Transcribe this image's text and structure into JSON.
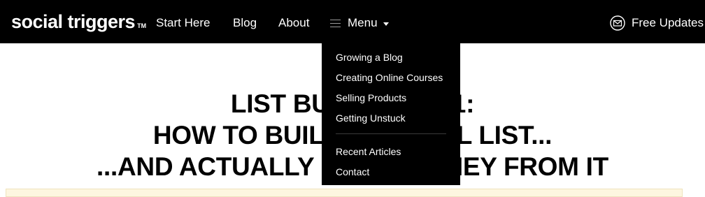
{
  "header": {
    "logo": "social triggers",
    "logo_tm": "TM",
    "nav": [
      {
        "label": "Start Here"
      },
      {
        "label": "Blog"
      },
      {
        "label": "About"
      }
    ],
    "menu_label": "Menu",
    "free_updates": "Free Updates"
  },
  "dropdown": {
    "items": [
      {
        "label": "Growing a Blog"
      },
      {
        "label": "Creating Online Courses"
      },
      {
        "label": "Selling Products"
      },
      {
        "label": "Getting Unstuck"
      }
    ],
    "secondary_items": [
      {
        "label": "Recent Articles"
      },
      {
        "label": "Contact"
      }
    ]
  },
  "hero": {
    "lines": [
      "LIST BUILDING 101:",
      "HOW TO BUILD AN EMAIL LIST...",
      "...AND ACTUALLY MAKE MONEY FROM IT"
    ]
  },
  "colors": {
    "nav_background": "#000000",
    "notice_background": "#fdf6e0"
  },
  "icons": [
    "hamburger-icon",
    "caret-down-icon",
    "mail-icon"
  ]
}
